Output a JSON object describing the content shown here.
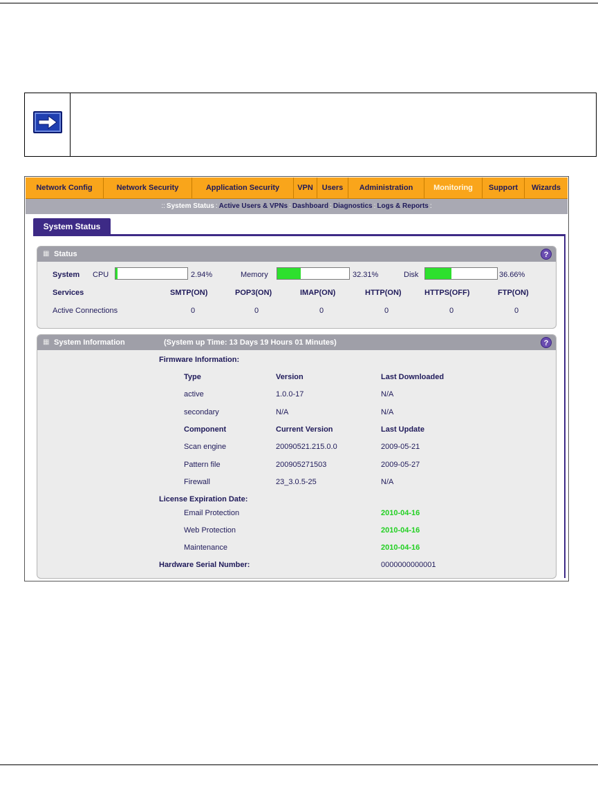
{
  "nav": {
    "items": [
      {
        "label": "Network Config",
        "active": false
      },
      {
        "label": "Network Security",
        "active": false
      },
      {
        "label": "Application Security",
        "active": false
      },
      {
        "label": "VPN",
        "active": false
      },
      {
        "label": "Users",
        "active": false
      },
      {
        "label": "Administration",
        "active": false
      },
      {
        "label": "Monitoring",
        "active": true
      },
      {
        "label": "Support",
        "active": false
      },
      {
        "label": "Wizards",
        "active": false
      }
    ]
  },
  "subnav": {
    "prefix": "::",
    "items": [
      "System Status",
      "Active Users & VPNs",
      "Dashboard",
      "Diagnostics",
      "Logs & Reports"
    ],
    "separator": ":",
    "current": "System Status"
  },
  "tab": {
    "label": "System Status"
  },
  "status_panel": {
    "title": "Status",
    "system_label": "System",
    "cpu": {
      "label": "CPU",
      "value": "2.94%",
      "percent": 2.94
    },
    "memory": {
      "label": "Memory",
      "value": "32.31%",
      "percent": 32.31
    },
    "disk": {
      "label": "Disk",
      "value": "36.66%",
      "percent": 36.66
    },
    "services_label": "Services",
    "services": [
      "SMTP(ON)",
      "POP3(ON)",
      "IMAP(ON)",
      "HTTP(ON)",
      "HTTPS(OFF)",
      "FTP(ON)"
    ],
    "active_connections_label": "Active Connections",
    "active_connections": [
      "0",
      "0",
      "0",
      "0",
      "0",
      "0"
    ]
  },
  "info_panel": {
    "title": "System Information",
    "uptime": "(System up Time: 13 Days 19 Hours 01 Minutes)",
    "firmware_heading": "Firmware Information:",
    "firmware_headers": [
      "Type",
      "Version",
      "Last Downloaded"
    ],
    "firmware_rows": [
      [
        "active",
        "1.0.0-17",
        "N/A"
      ],
      [
        "secondary",
        "N/A",
        "N/A"
      ]
    ],
    "component_headers": [
      "Component",
      "Current Version",
      "Last Update"
    ],
    "component_rows": [
      [
        "Scan engine",
        "20090521.215.0.0",
        "2009-05-21"
      ],
      [
        "Pattern file",
        "200905271503",
        "2009-05-27"
      ],
      [
        "Firewall",
        "23_3.0.5-25",
        "N/A"
      ]
    ],
    "license_heading": "License Expiration Date:",
    "license_rows": [
      [
        "Email Protection",
        "2010-04-16"
      ],
      [
        "Web Protection",
        "2010-04-16"
      ],
      [
        "Maintenance",
        "2010-04-16"
      ]
    ],
    "serial_label": "Hardware Serial Number:",
    "serial_value": "0000000000001"
  },
  "colors": {
    "nav_bg": "#f9a51b",
    "tab_bg": "#3d2a86",
    "license_green": "#22d022",
    "bar_fill": "#2ee02e"
  },
  "icons": {
    "note": "right-arrow-icon",
    "help": "help-icon",
    "grip": "grip-icon"
  }
}
